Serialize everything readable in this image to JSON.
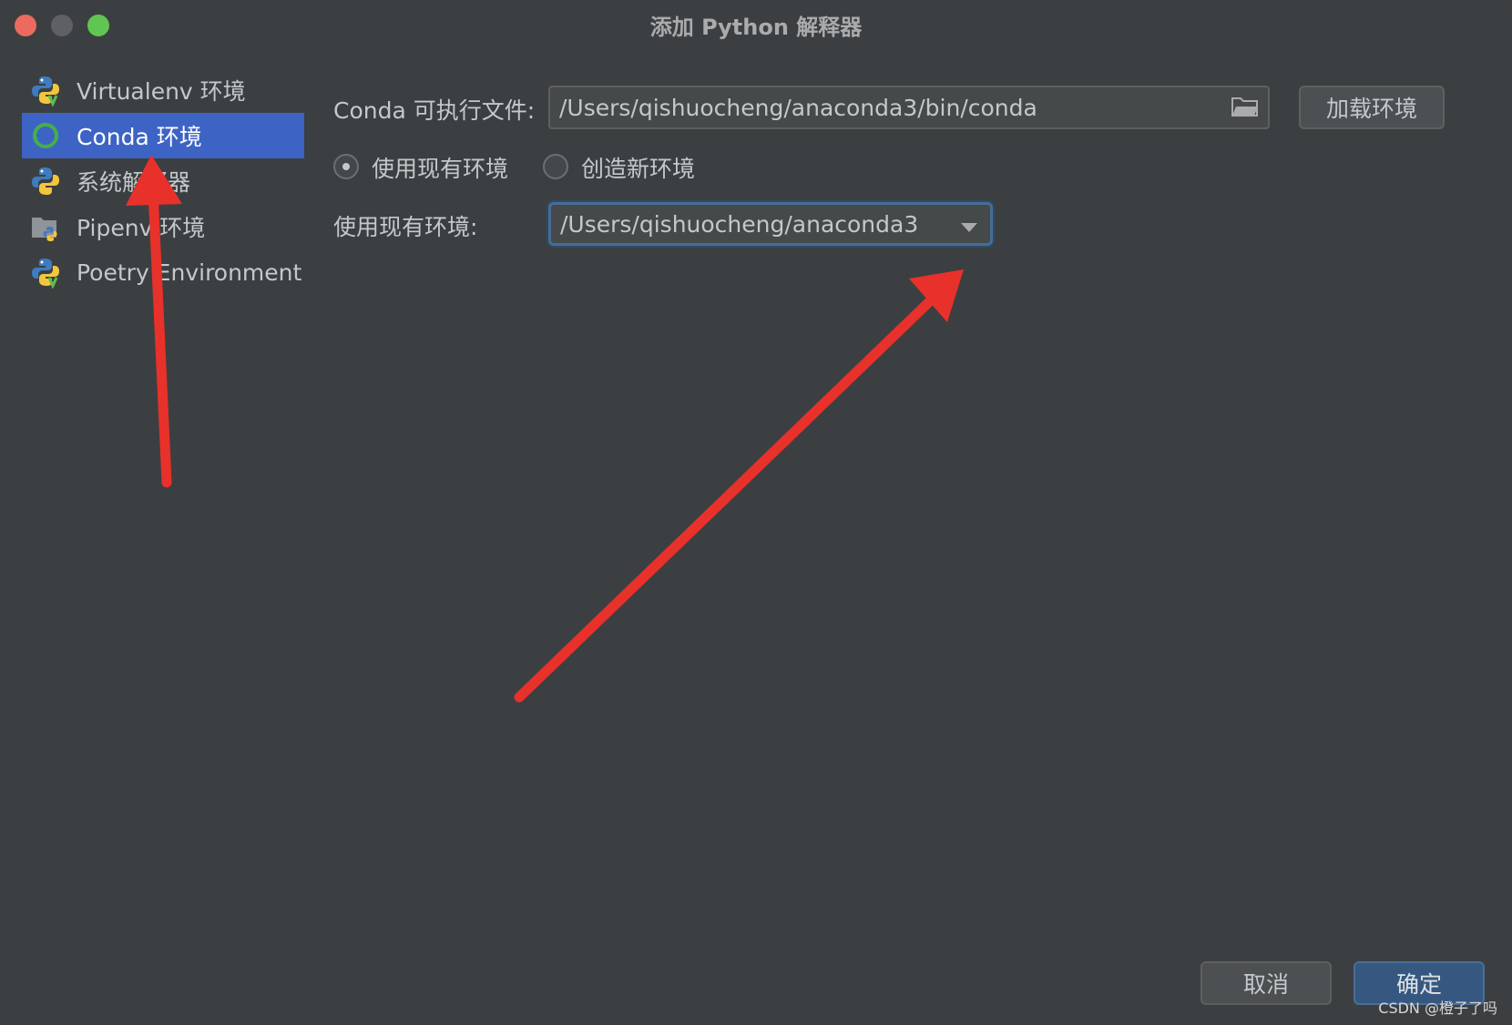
{
  "window": {
    "title": "添加 Python 解释器"
  },
  "sidebar": {
    "items": [
      {
        "label": "Virtualenv 环境",
        "icon": "python-virtualenv-icon"
      },
      {
        "label": "Conda 环境",
        "icon": "conda-icon",
        "selected": true
      },
      {
        "label": "系统解释器",
        "icon": "python-icon"
      },
      {
        "label": "Pipenv 环境",
        "icon": "pipenv-icon"
      },
      {
        "label": "Poetry Environment",
        "icon": "python-poetry-icon"
      }
    ]
  },
  "main": {
    "conda_exec_label": "Conda 可执行文件:",
    "conda_exec_path": "/Users/qishuocheng/anaconda3/bin/conda",
    "load_env_button": "加载环境",
    "radio_existing": "使用现有环境",
    "radio_new": "创造新环境",
    "existing_env_label": "使用现有环境:",
    "existing_env_value": "/Users/qishuocheng/anaconda3"
  },
  "footer": {
    "cancel": "取消",
    "ok": "确定"
  },
  "watermark": "CSDN @橙子了吗",
  "colors": {
    "background": "#3c3f41",
    "selection": "#3d63c4",
    "primary_button": "#365880",
    "annotation_arrow": "#e8312a"
  }
}
